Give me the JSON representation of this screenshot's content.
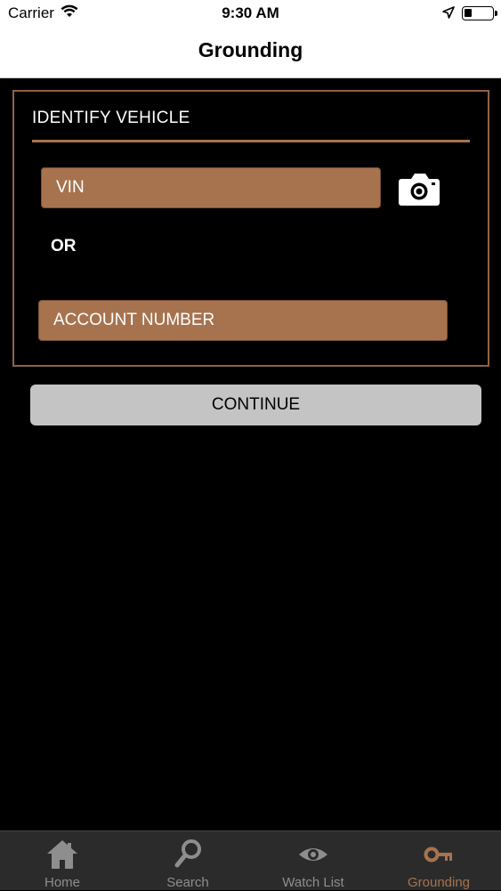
{
  "status_bar": {
    "carrier": "Carrier",
    "time": "9:30 AM"
  },
  "nav": {
    "title": "Grounding"
  },
  "panel": {
    "title": "IDENTIFY VEHICLE",
    "vin_placeholder": "VIN",
    "or_label": "OR",
    "account_placeholder": "ACCOUNT NUMBER"
  },
  "continue_label": "CONTINUE",
  "tabs": [
    {
      "label": "Home",
      "icon": "home-icon",
      "active": false
    },
    {
      "label": "Search",
      "icon": "search-icon",
      "active": false
    },
    {
      "label": "Watch List",
      "icon": "eye-icon",
      "active": false
    },
    {
      "label": "Grounding",
      "icon": "key-icon",
      "active": true
    }
  ],
  "colors": {
    "accent": "#a7734f",
    "border": "#8f6247",
    "tab_bg": "#2b2b2b",
    "button": "#c4c4c4"
  }
}
